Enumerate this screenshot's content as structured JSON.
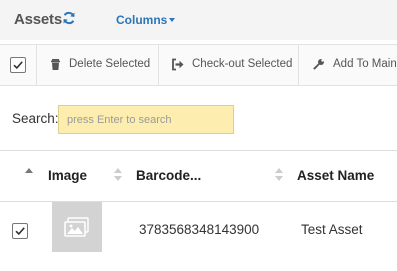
{
  "header": {
    "title": "Assets",
    "columns_label": "Columns",
    "icons": {
      "refresh": "refresh-icon",
      "caret": "caret-down-icon"
    }
  },
  "toolbar": {
    "delete_label": "Delete Selected",
    "checkout_label": "Check-out Selected",
    "maintenance_label": "Add To Maint",
    "icons": {
      "delete": "trash-icon",
      "checkout": "sign-out-icon",
      "maintenance": "wrench-icon"
    }
  },
  "search": {
    "label": "Search:",
    "value": "",
    "placeholder": "press Enter to search"
  },
  "table": {
    "headers": [
      "Image",
      "Barcode...",
      "Asset Name"
    ],
    "rows": [
      {
        "selected": true,
        "image": "image-placeholder-icon",
        "barcode": "3783568348143900",
        "asset_name": "Test Asset"
      }
    ]
  },
  "colors": {
    "link": "#2a76b8",
    "search_bg": "#fdeeb0",
    "thumb_bg": "#d3d3d3"
  }
}
